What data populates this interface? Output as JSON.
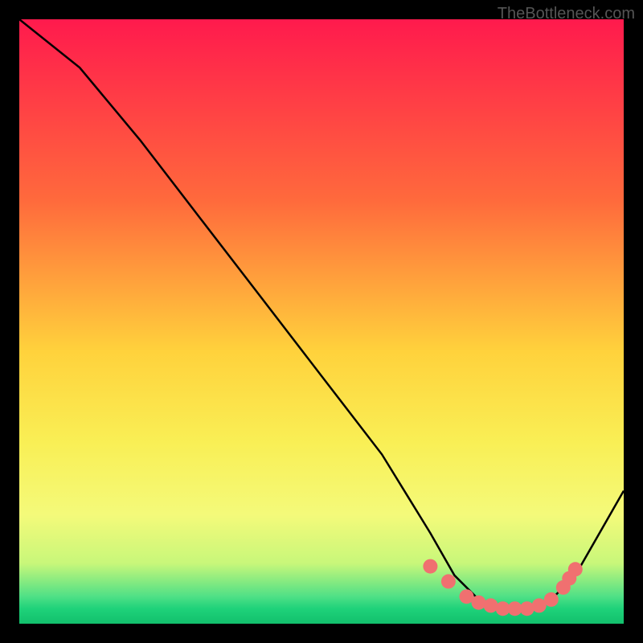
{
  "watermark": "TheBottleneck.com",
  "chart_data": {
    "type": "line",
    "title": "",
    "xlabel": "",
    "ylabel": "",
    "xlim": [
      0,
      100
    ],
    "ylim": [
      0,
      100
    ],
    "grid": false,
    "series": [
      {
        "name": "curve",
        "x": [
          0,
          10,
          20,
          30,
          40,
          50,
          60,
          68,
          72,
          76,
          80,
          84,
          88,
          92,
          100
        ],
        "y": [
          100,
          92,
          80,
          67,
          54,
          41,
          28,
          15,
          8,
          4,
          2,
          2,
          4,
          8,
          22
        ]
      }
    ],
    "markers": {
      "name": "dots",
      "color": "#f07070",
      "x": [
        68,
        71,
        74,
        76,
        78,
        80,
        82,
        84,
        86,
        88,
        90,
        91,
        92
      ],
      "y": [
        9.5,
        7,
        4.5,
        3.5,
        3,
        2.5,
        2.5,
        2.5,
        3,
        4,
        6,
        7.5,
        9
      ]
    },
    "background_gradient": {
      "stops": [
        {
          "offset": 0.0,
          "color": "#ff1a4d"
        },
        {
          "offset": 0.3,
          "color": "#ff6a3c"
        },
        {
          "offset": 0.55,
          "color": "#ffd23c"
        },
        {
          "offset": 0.7,
          "color": "#f9ef55"
        },
        {
          "offset": 0.82,
          "color": "#f4fa7a"
        },
        {
          "offset": 0.9,
          "color": "#c8f77a"
        },
        {
          "offset": 0.955,
          "color": "#4fe086"
        },
        {
          "offset": 0.975,
          "color": "#1fd27a"
        },
        {
          "offset": 1.0,
          "color": "#12c06c"
        }
      ]
    }
  }
}
